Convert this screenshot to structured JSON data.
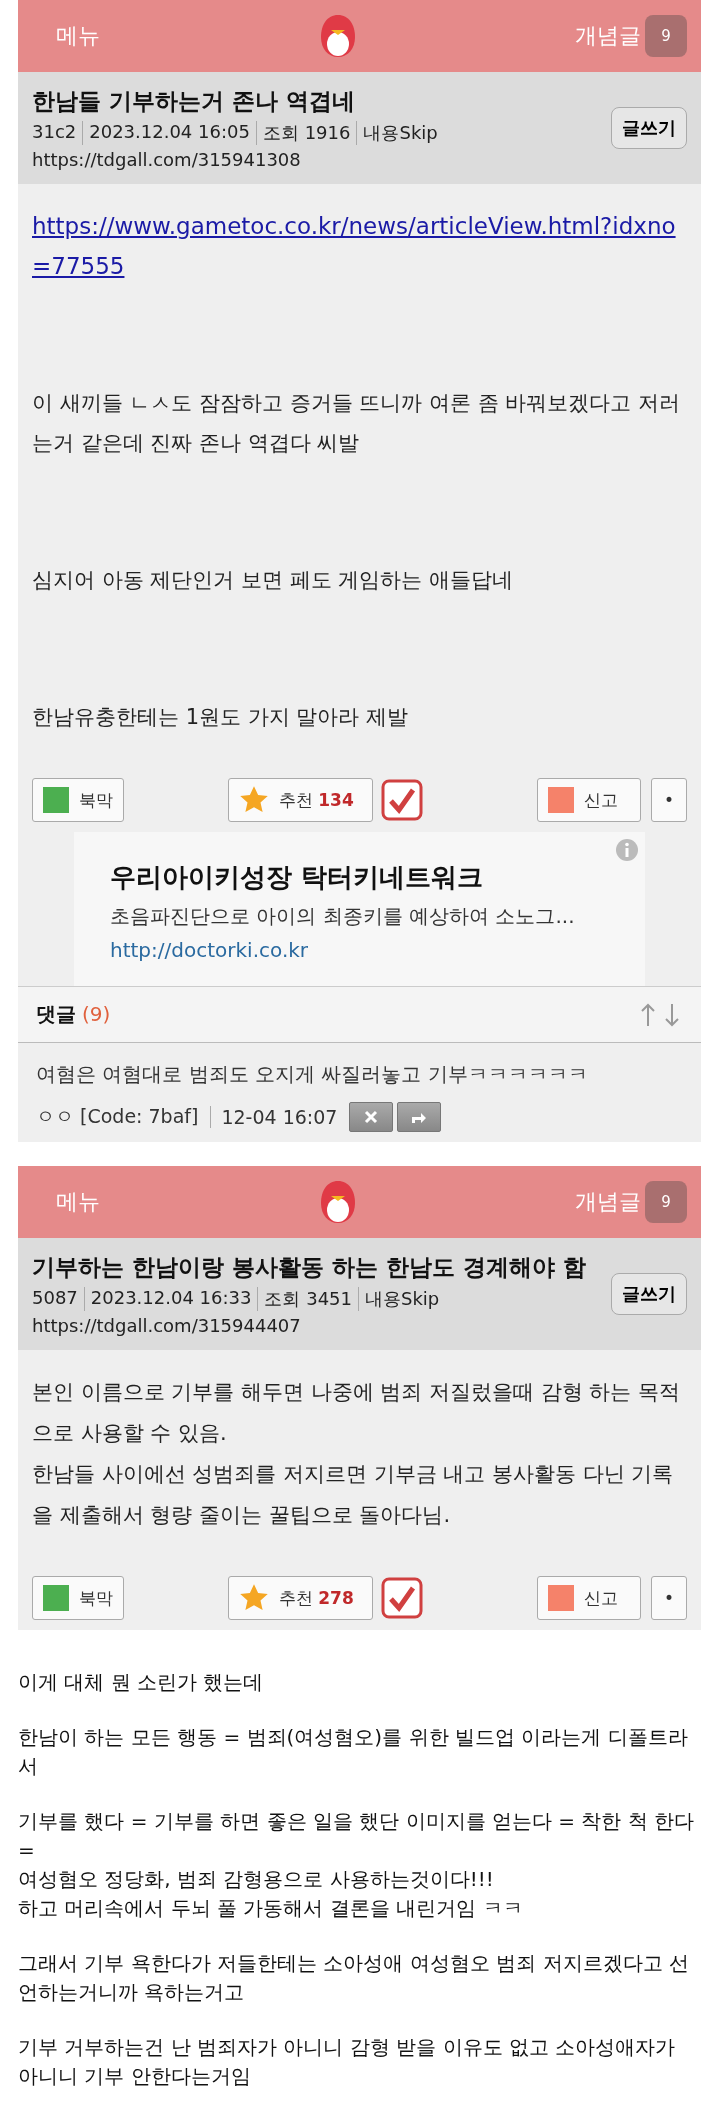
{
  "posts": [
    {
      "header": {
        "menu": "메뉴",
        "concept": "개념글",
        "badge": "9"
      },
      "title": "한남들 기부하는거 존나 역겹네",
      "meta": [
        "31c2",
        "2023.12.04 16:05",
        "조회 1916",
        "내용Skip"
      ],
      "url": "https://tdgall.com/315941308",
      "write_button": "글쓰기",
      "body": [
        {
          "kind": "link",
          "text": "https://www.gametoc.co.kr/news/articleView.html?idxno=77555"
        },
        {
          "kind": "text",
          "lines": [
            "이 새끼들 ㄴㅅ도 잠잠하고 증거들 뜨니까 여론 좀 바꿔보겠다고 저러는거 같은데 진짜 존나 역겹다 씨발"
          ]
        },
        {
          "kind": "text",
          "lines": [
            "심지어 아동 제단인거 보면 페도 게임하는 애들답네"
          ]
        },
        {
          "kind": "text",
          "lines": [
            "한남유충한테는 1원도 가지 말아라 제발"
          ]
        }
      ],
      "actions": {
        "bookmark": "북막",
        "recommend": "추천",
        "recommend_count": "134",
        "report": "신고",
        "more": "•"
      },
      "ad": {
        "title": "우리아이키성장 탁터키네트워크",
        "description": "초음파진단으로 아이의 최종키를 예상하여 소노그...",
        "url": "http://doctorki.co.kr"
      },
      "comments": {
        "label": "댓글",
        "count": "(9)",
        "items": [
          {
            "text": "여혐은 여혐대로 범죄도 오지게 싸질러놓고 기부ㅋㅋㅋㅋㅋㅋ",
            "author": "ㅇㅇ [Code: 7baf]",
            "time": "12-04 16:07"
          }
        ]
      }
    },
    {
      "header": {
        "menu": "메뉴",
        "concept": "개념글",
        "badge": "9"
      },
      "title": "기부하는 한남이랑 봉사활동 하는 한남도 경계해야 함",
      "meta": [
        "5087",
        "2023.12.04 16:33",
        "조회 3451",
        "내용Skip"
      ],
      "url": "https://tdgall.com/315944407",
      "write_button": "글쓰기",
      "body": [
        {
          "kind": "text",
          "lines": [
            "본인 이름으로 기부를 해두면 나중에 범죄 저질렀을때 감형 하는 목적으로 사용할 수 있음.",
            "한남들 사이에선 성범죄를 저지르면 기부금 내고 봉사활동 다닌 기록을 제출해서 형량 줄이는 꿀팁으로 돌아다님."
          ]
        }
      ],
      "actions": {
        "bookmark": "북막",
        "recommend": "추천",
        "recommend_count": "278",
        "report": "신고",
        "more": "•"
      }
    }
  ],
  "commentary": [
    [
      "이게 대체 뭔 소린가 했는데"
    ],
    [
      "한남이 하는 모든 행동 = 범죄(여성혐오)를 위한 빌드업 이라는게 디폴트라서"
    ],
    [
      "기부를 했다 = 기부를 하면 좋은 일을 했단 이미지를 얻는다 = 착한 척 한다 =",
      "여성혐오 정당화, 범죄 감형용으로 사용하는것이다!!!",
      "하고 머리속에서 두뇌 풀 가동해서 결론을 내린거임 ㅋㅋ"
    ],
    [
      "그래서 기부 욕한다가 저들한테는 소아성애 여성혐오 범죄 저지르겠다고 선언하는거니까 욕하는거고"
    ],
    [
      "기부 거부하는건 난 범죄자가 아니니 감형 받을 이유도 없고 소아성애자가 아니니 기부 안한다는거임"
    ]
  ]
}
